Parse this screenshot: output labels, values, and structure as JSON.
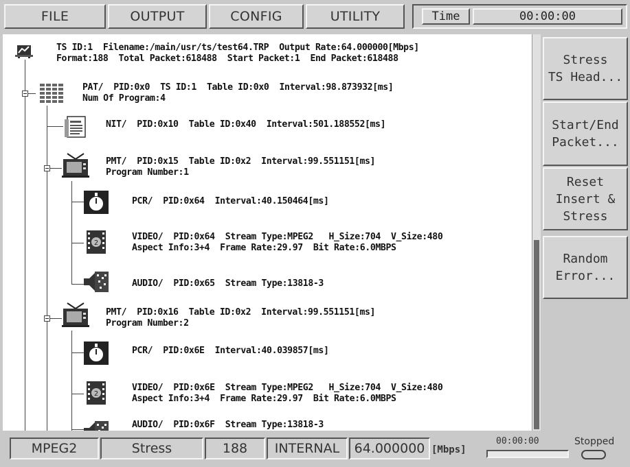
{
  "menu": {
    "file": "FILE",
    "output": "OUTPUT",
    "config": "CONFIG",
    "utility": "UTILITY"
  },
  "time": {
    "label": "Time",
    "value": "00:00:00"
  },
  "tree": {
    "ts_line1": "TS ID:1  Filename:/main/usr/ts/test64.TRP  Output Rate:64.000000[Mbps]",
    "ts_line2": "Format:188  Total Packet:618488  Start Packet:1  End Packet:618488",
    "pat_line1": "PAT/  PID:0x0  TS ID:1  Table ID:0x0  Interval:98.873932[ms]",
    "pat_line2": "Num Of Program:4",
    "nit_line1": "NIT/  PID:0x10  Table ID:0x40  Interval:501.188552[ms]",
    "pmt1_line1": "PMT/  PID:0x15  Table ID:0x2  Interval:99.551151[ms]",
    "pmt1_line2": "Program Number:1",
    "pcr1_line1": "PCR/  PID:0x64  Interval:40.150464[ms]",
    "video1_line1": "VIDEO/  PID:0x64  Stream Type:MPEG2   H_Size:704  V_Size:480",
    "video1_line2": "Aspect Info:3+4  Frame Rate:29.97  Bit Rate:6.0MBPS",
    "audio1_line1": "AUDIO/  PID:0x65  Stream Type:13818-3",
    "pmt2_line1": "PMT/  PID:0x16  Table ID:0x2  Interval:99.551151[ms]",
    "pmt2_line2": "Program Number:2",
    "pcr2_line1": "PCR/  PID:0x6E  Interval:40.039857[ms]",
    "video2_line1": "VIDEO/  PID:0x6E  Stream Type:MPEG2   H_Size:704  V_Size:480",
    "video2_line2": "Aspect Info:3+4  Frame Rate:29.97  Bit Rate:6.0MBPS",
    "audio2_line1": "AUDIO/  PID:0x6F  Stream Type:13818-3"
  },
  "side": {
    "stress_ts": "Stress\nTS Head...",
    "start_end": "Start/End\nPacket...",
    "reset": "Reset\nInsert &\nStress",
    "random": "Random\nError..."
  },
  "status": {
    "format": "MPEG2",
    "mode": "Stress",
    "packet": "188",
    "clock": "INTERNAL",
    "rate": "64.000000",
    "unit": "[Mbps]",
    "elapsed": "00:00:00",
    "state": "Stopped",
    "progress": 0
  }
}
